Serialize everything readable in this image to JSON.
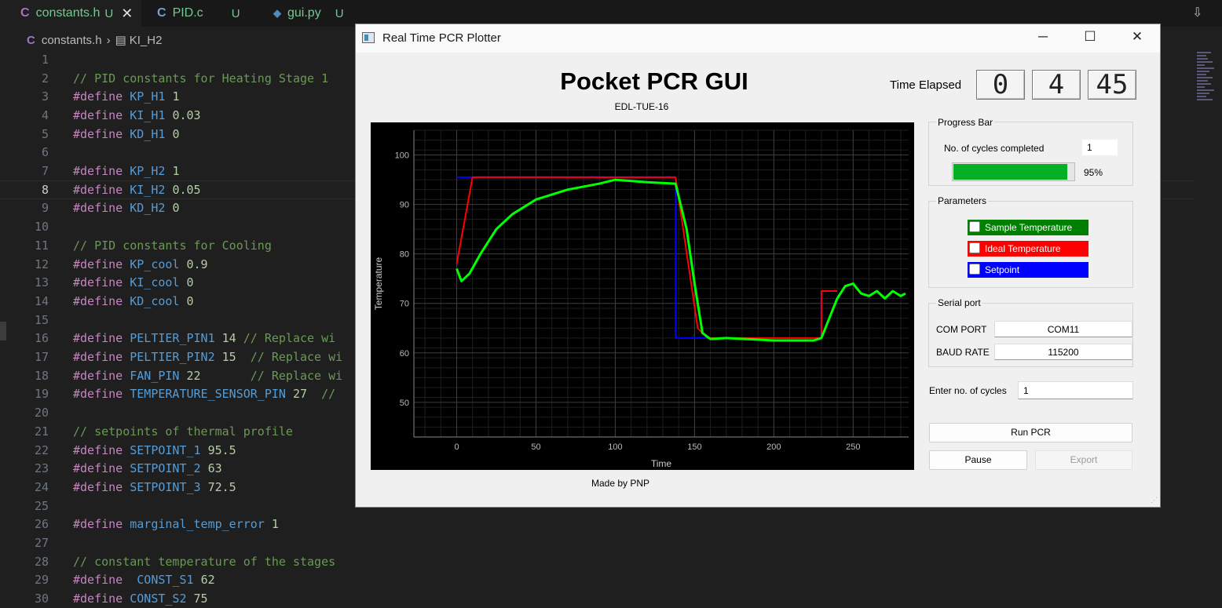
{
  "editor": {
    "tabs": [
      {
        "icon": "C",
        "name": "constants.h",
        "badge": "U",
        "active": true
      },
      {
        "icon": "C",
        "name": "PID.c",
        "badge": "U",
        "active": false
      },
      {
        "icon": "py",
        "name": "gui.py",
        "badge": "U",
        "active": false
      }
    ],
    "breadcrumb": {
      "file": "constants.h",
      "symbol": "KI_H2"
    },
    "lines": [
      "",
      "// PID constants for Heating Stage 1",
      "#define KP_H1 1",
      "#define KI_H1 0.03",
      "#define KD_H1 0",
      "",
      "#define KP_H2 1",
      "#define KI_H2 0.05",
      "#define KD_H2 0",
      "",
      "// PID constants for Cooling",
      "#define KP_cool 0.9",
      "#define KI_cool 0",
      "#define KD_cool 0",
      "",
      "#define PELTIER_PIN1 14 // Replace wi",
      "#define PELTIER_PIN2 15  // Replace wi",
      "#define FAN_PIN 22       // Replace wi",
      "#define TEMPERATURE_SENSOR_PIN 27  //",
      "",
      "// setpoints of thermal profile",
      "#define SETPOINT_1 95.5",
      "#define SETPOINT_2 63",
      "#define SETPOINT_3 72.5",
      "",
      "#define marginal_temp_error 1",
      "",
      "// constant temperature of the stages",
      "#define  CONST_S1 62",
      "#define CONST_S2 75"
    ],
    "current_line": 8
  },
  "window": {
    "title": "Real Time PCR Plotter",
    "app_title": "Pocket PCR GUI",
    "app_subtitle": "EDL-TUE-16",
    "time_label": "Time Elapsed",
    "time_digits": [
      "0",
      "4",
      "45"
    ],
    "footer": "Made by PNP",
    "progress": {
      "group_title": "Progress Bar",
      "cycles_label": "No. of cycles completed",
      "cycles_value": "1",
      "percent": 95,
      "percent_label": "95%"
    },
    "parameters": {
      "group_title": "Parameters",
      "items": [
        {
          "label": "Sample Temperature",
          "color": "#008000",
          "checked": false
        },
        {
          "label": "Ideal Temperature",
          "color": "#ff0000",
          "checked": false
        },
        {
          "label": "Setpoint",
          "color": "#0000ff",
          "checked": false
        }
      ]
    },
    "serial": {
      "group_title": "Serial port",
      "com_label": "COM PORT",
      "com_value": "COM11",
      "baud_label": "BAUD RATE",
      "baud_value": "115200"
    },
    "cycles_input": {
      "label": "Enter no. of cycles",
      "value": "1"
    },
    "buttons": {
      "run": "Run PCR",
      "pause": "Pause",
      "export": "Export"
    }
  },
  "chart_data": {
    "type": "line",
    "xlabel": "Time",
    "ylabel": "Temperature",
    "xlim": [
      -27,
      285
    ],
    "ylim": [
      43,
      105
    ],
    "xticks": [
      0,
      50,
      100,
      150,
      200,
      250
    ],
    "yticks": [
      50,
      60,
      70,
      80,
      90,
      100
    ],
    "grid": true,
    "series": [
      {
        "color": "#0000ff",
        "x": [
          0,
          138,
          138,
          230,
          230,
          240
        ],
        "y": [
          95.5,
          95.5,
          63,
          63,
          72.5,
          72.5
        ]
      },
      {
        "color": "#ff0000",
        "x": [
          0,
          10,
          138,
          152,
          158,
          230,
          230,
          240
        ],
        "y": [
          78,
          95.5,
          95.5,
          65,
          63,
          63,
          72.5,
          72.5
        ]
      },
      {
        "color": "#00ff00",
        "x": [
          0,
          3,
          8,
          15,
          25,
          35,
          50,
          70,
          90,
          100,
          120,
          138,
          145,
          150,
          155,
          160,
          170,
          200,
          225,
          230,
          235,
          240,
          245,
          250,
          255,
          260,
          265,
          270,
          275,
          280,
          283
        ],
        "y": [
          77,
          74.5,
          76,
          80,
          85,
          88,
          91,
          93,
          94.2,
          95,
          94.5,
          94.2,
          85,
          74,
          64,
          62.8,
          63,
          62.5,
          62.5,
          63,
          67,
          71,
          73.5,
          74,
          72,
          71.5,
          72.5,
          71,
          72.5,
          71.5,
          72
        ]
      }
    ]
  }
}
